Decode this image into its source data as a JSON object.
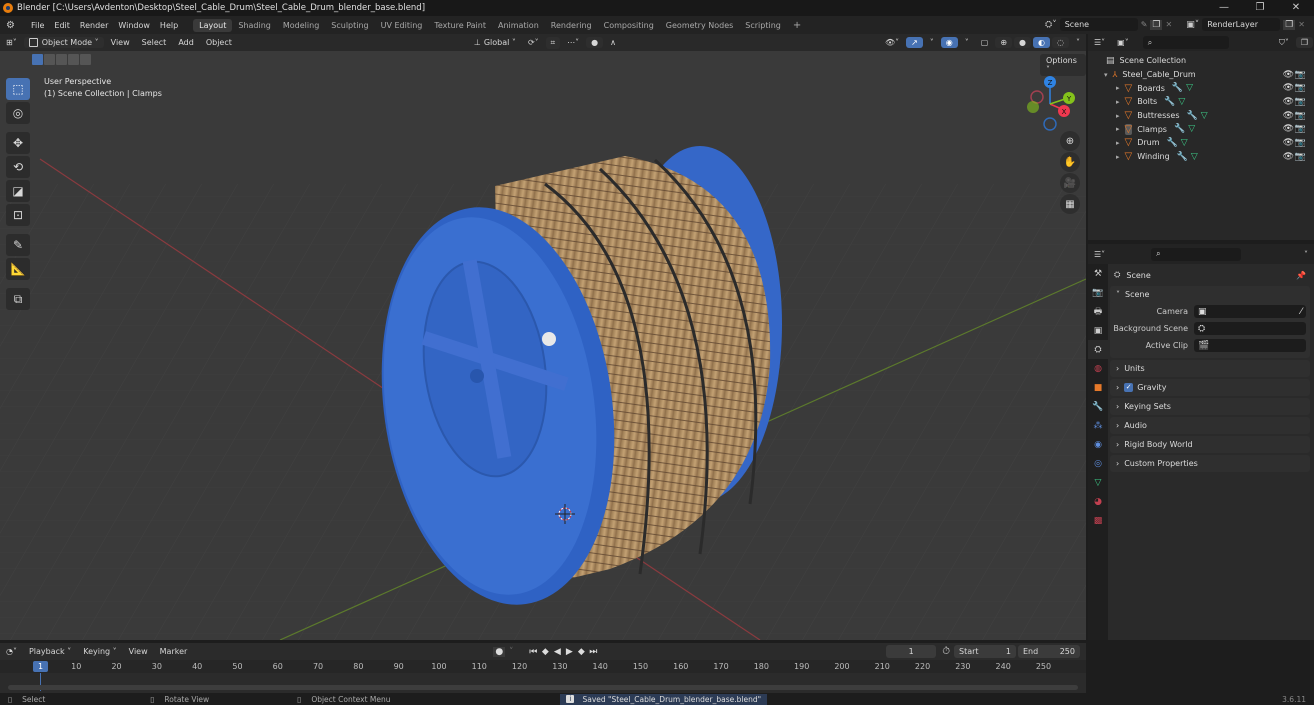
{
  "window": {
    "title": "Blender [C:\\Users\\Avdenton\\Desktop\\Steel_Cable_Drum\\Steel_Cable_Drum_blender_base.blend]",
    "controls": [
      "—",
      "❐",
      "✕"
    ]
  },
  "menubar": {
    "menus": [
      "File",
      "Edit",
      "Render",
      "Window",
      "Help"
    ],
    "workspaces": [
      "Layout",
      "Shading",
      "Modeling",
      "Sculpting",
      "UV Editing",
      "Texture Paint",
      "Animation",
      "Rendering",
      "Compositing",
      "Geometry Nodes",
      "Scripting"
    ],
    "active_workspace": "Layout",
    "add_workspace": "+",
    "scene": "Scene",
    "view_layer": "RenderLayer"
  },
  "viewport": {
    "mode": "Object Mode",
    "menus": [
      "View",
      "Select",
      "Add",
      "Object"
    ],
    "transform_orientation": "Global",
    "options_label": "Options",
    "info_line1": "User Perspective",
    "info_line2": "(1) Scene Collection | Clamps",
    "gizmo_axes": {
      "x": "X",
      "y": "Y",
      "z": "Z"
    },
    "colors": {
      "x": "#f0384f",
      "y": "#84c21b",
      "z": "#2f83e3",
      "drum_blue": "#3a6fd0",
      "wood": "#b08a5c"
    }
  },
  "outliner": {
    "root": "Scene Collection",
    "collection": "Steel_Cable_Drum",
    "objects": [
      "Boards",
      "Bolts",
      "Buttresses",
      "Clamps",
      "Drum",
      "Winding"
    ],
    "active_object": "Clamps"
  },
  "properties": {
    "context": "Scene",
    "panel_scene": "Scene",
    "camera_label": "Camera",
    "background_scene_label": "Background Scene",
    "active_clip_label": "Active Clip",
    "camera_value": "",
    "background_scene_value": "",
    "active_clip_value": "",
    "collapsed_panels": [
      "Units",
      "Gravity",
      "Keying Sets",
      "Audio",
      "Rigid Body World",
      "Custom Properties"
    ],
    "gravity_enabled": true
  },
  "timeline": {
    "menus": [
      "Playback",
      "Keying",
      "View",
      "Marker"
    ],
    "current_frame": "1",
    "start_label": "Start",
    "start": "1",
    "end_label": "End",
    "end": "250",
    "ticks": [
      "10",
      "20",
      "30",
      "40",
      "50",
      "60",
      "70",
      "80",
      "90",
      "100",
      "110",
      "120",
      "130",
      "140",
      "150",
      "160",
      "170",
      "180",
      "190",
      "200",
      "210",
      "220",
      "230",
      "240",
      "250"
    ]
  },
  "statusbar": {
    "select": "Select",
    "rotate": "Rotate View",
    "context_menu": "Object Context Menu",
    "message": "Saved \"Steel_Cable_Drum_blender_base.blend\"",
    "version": "3.6.11"
  }
}
